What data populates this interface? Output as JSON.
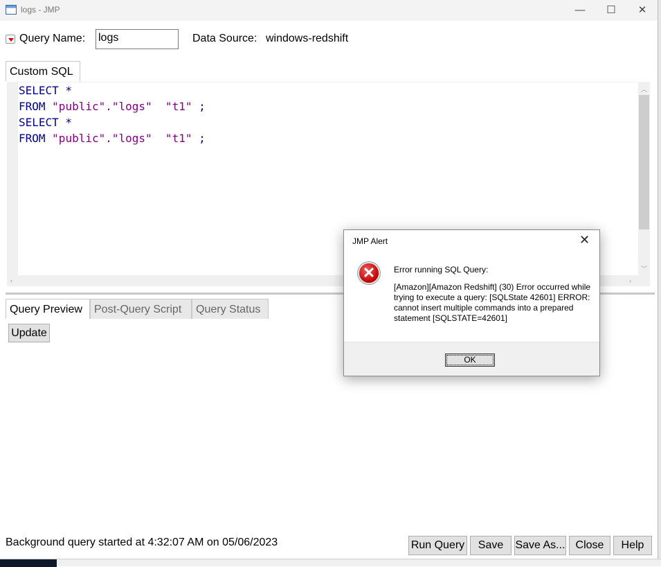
{
  "window": {
    "title": "logs - JMP",
    "minimize": "—",
    "maximize": "☐",
    "close": "✕"
  },
  "query": {
    "name_label": "Query Name:",
    "name_value": "logs",
    "source_label": "Data Source:",
    "source_value": "windows-redshift"
  },
  "sql_tab": "Custom SQL",
  "sql_lines": [
    {
      "kw": "SELECT *",
      "s": ""
    },
    {
      "kw": "FROM ",
      "s": "\"public\".\"logs\"  \"t1\" ",
      "end": ";"
    },
    {
      "kw": "SELECT *",
      "s": ""
    },
    {
      "kw": "FROM ",
      "s": "\"public\".\"logs\"  \"t1\" ",
      "end": ";"
    }
  ],
  "lower_tabs": [
    "Query Preview",
    "Post-Query Script",
    "Query Status"
  ],
  "update_button": "Update",
  "status": "Background query started at 4:32:07 AM on 05/06/2023",
  "buttons": [
    "Run Query",
    "Save",
    "Save As...",
    "Close",
    "Help"
  ],
  "alert": {
    "title": "JMP Alert",
    "close": "✕",
    "heading": "Error running SQL Query:",
    "message": "[Amazon][Amazon Redshift] (30) Error occurred while trying to execute a query: [SQLState 42601] ERROR: cannot insert multiple commands into a prepared statement [SQLSTATE=42601]",
    "ok": "OK",
    "icon": "✕"
  }
}
